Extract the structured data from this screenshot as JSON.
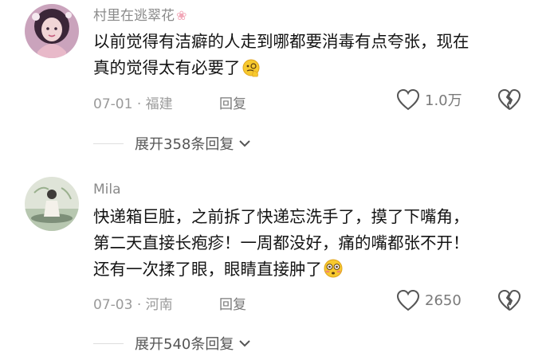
{
  "comments": [
    {
      "username": "村里在逃翠花",
      "username_badge": "flower",
      "text_lines": [
        "以前觉得有洁癖的人走到哪都要消毒有点夸张，现在",
        "真的觉得太有必要了"
      ],
      "emoji": "face-with-monocle-emoji",
      "date": "07-01",
      "location": "福建",
      "reply_label": "回复",
      "like_count": "1.0万",
      "expand_label": "展开358条回复"
    },
    {
      "username": "Mila",
      "text_lines": [
        "快递箱巨脏，之前拆了快递忘洗手了，摸了下嘴角，",
        "第二天直接长疱疹！一周都没好，痛的嘴都张不开！",
        "还有一次揉了眼，眼睛直接肿了"
      ],
      "emoji": "flushed-face-emoji",
      "date": "07-03",
      "location": "河南",
      "reply_label": "回复",
      "like_count": "2650",
      "expand_label": "展开540条回复"
    }
  ],
  "colors": {
    "text": "#141414",
    "meta": "#9a9a9a",
    "username": "#8a8a8a"
  }
}
